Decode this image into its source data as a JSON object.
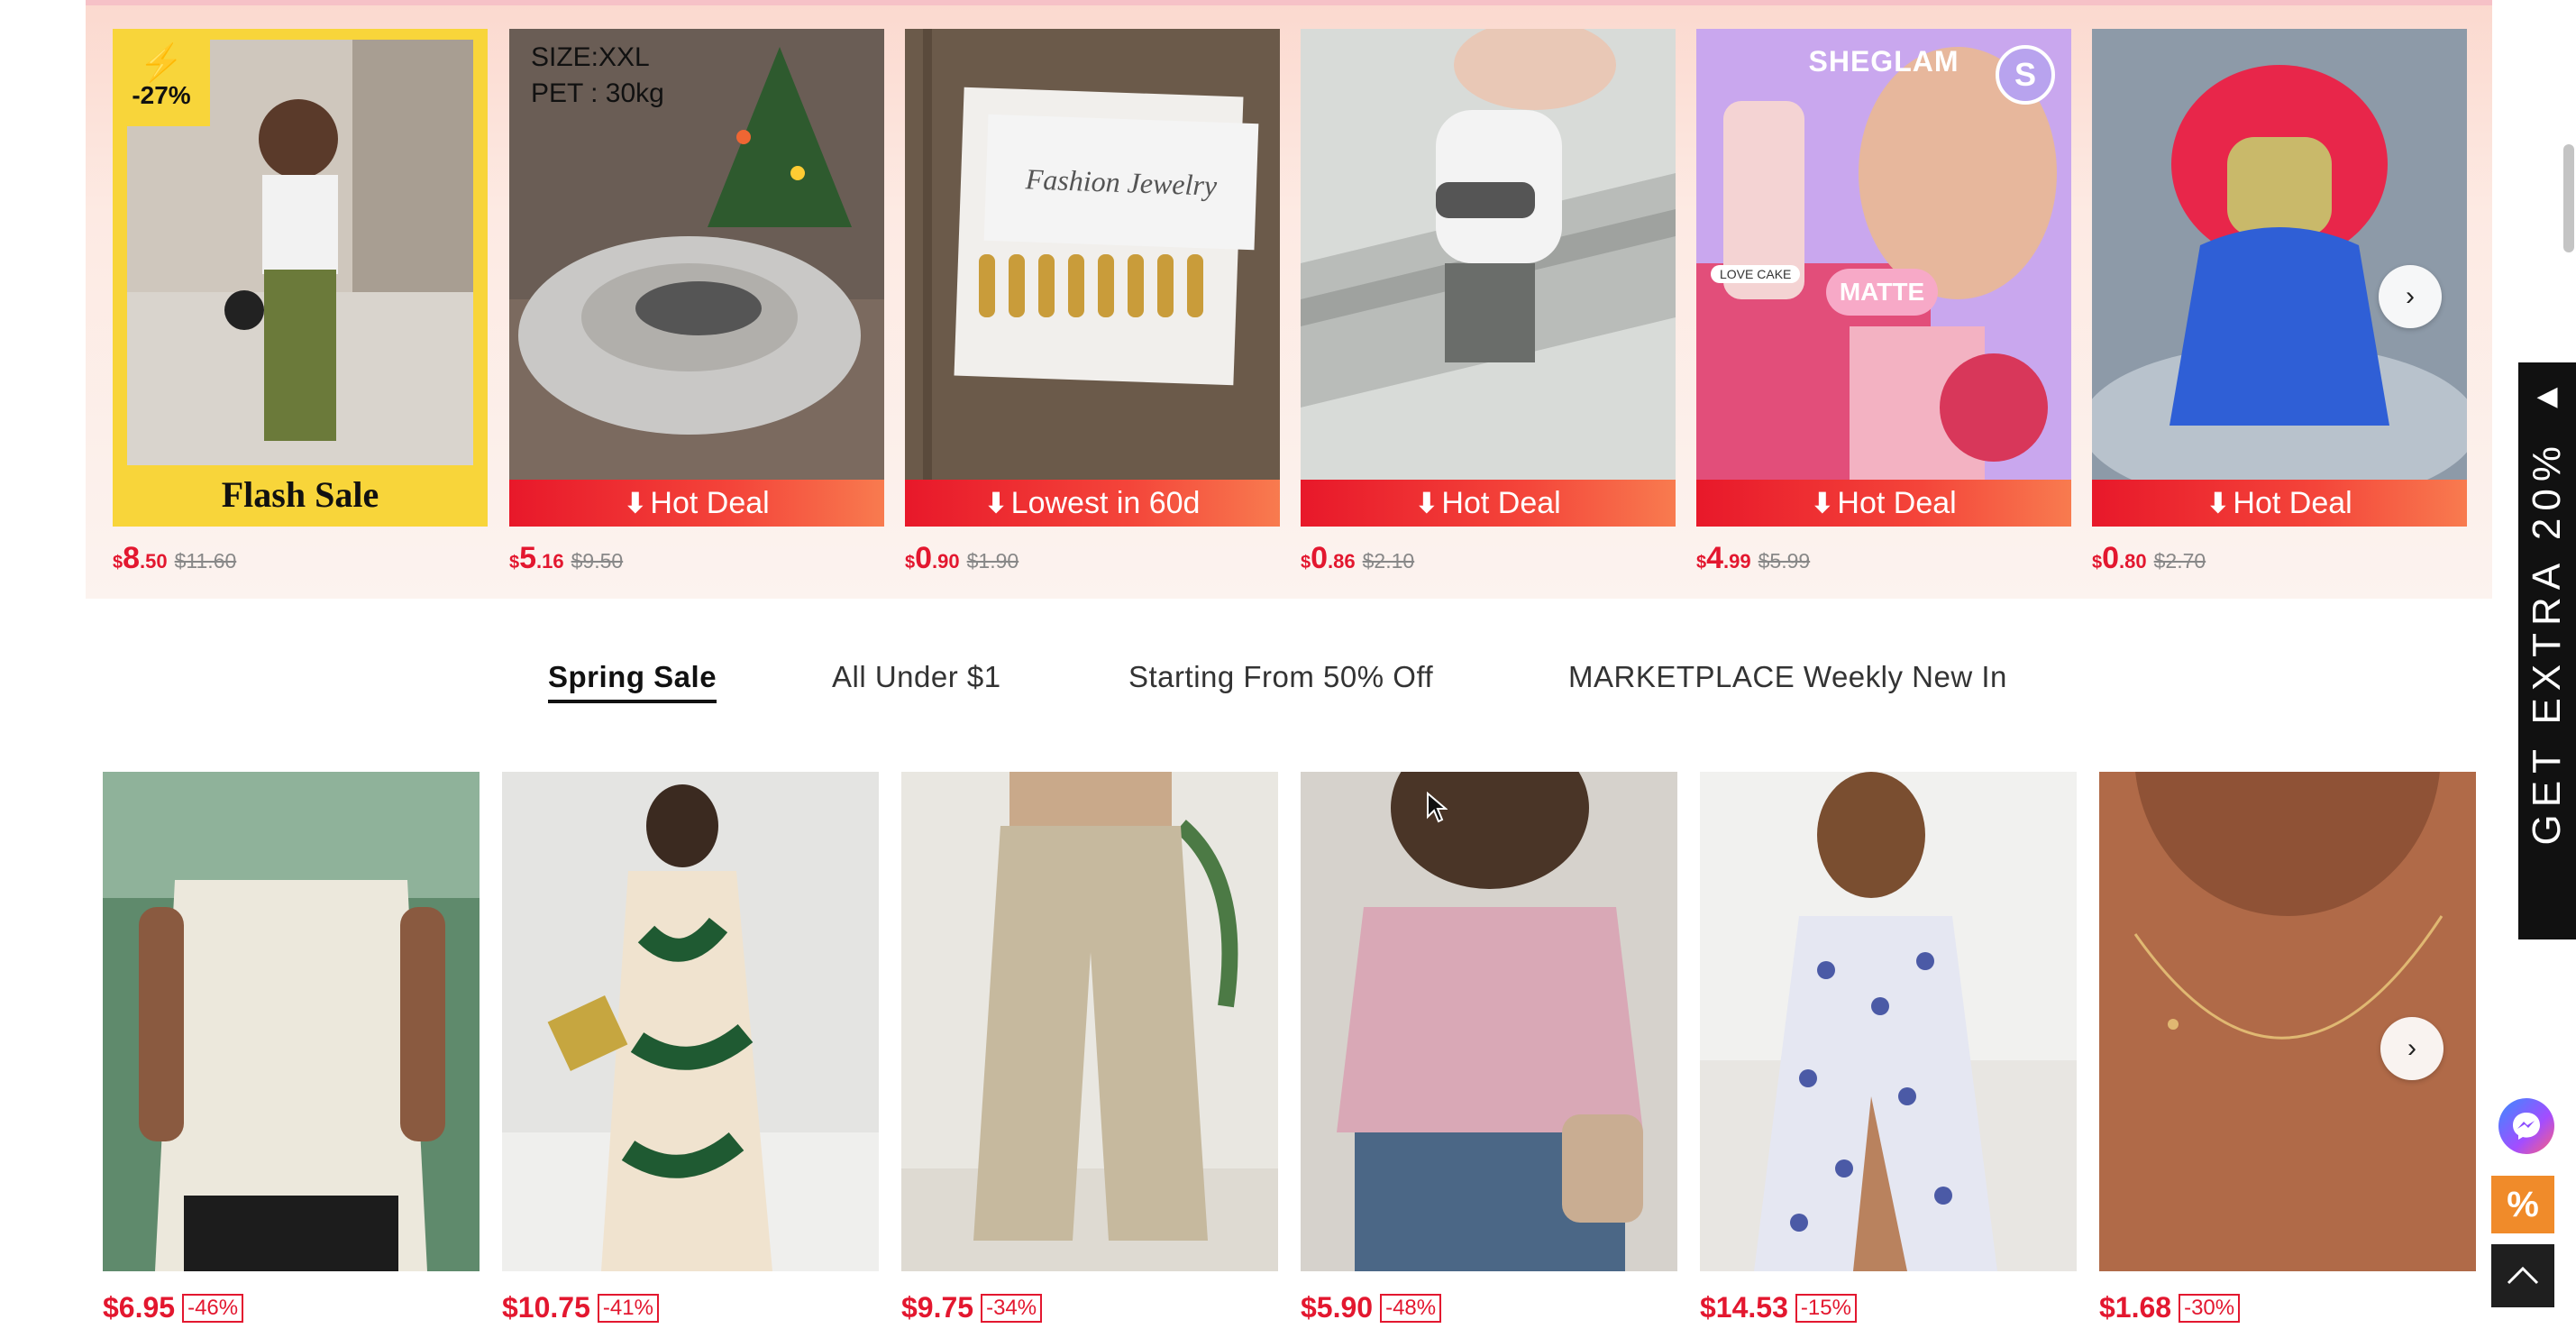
{
  "deals": [
    {
      "badge_discount": "-27%",
      "label": "Flash Sale",
      "currency": "$",
      "price_whole": "8",
      "price_cents": ".50",
      "old_price": "$11.60"
    },
    {
      "size_text": "SIZE:XXL",
      "pet_text": "PET : 30kg",
      "label": "Hot Deal",
      "currency": "$",
      "price_whole": "5",
      "price_cents": ".16",
      "old_price": "$9.50"
    },
    {
      "card_text": "Fashion Jewelry",
      "label": "Lowest in 60d",
      "currency": "$",
      "price_whole": "0",
      "price_cents": ".90",
      "old_price": "$1.90"
    },
    {
      "label": "Hot Deal",
      "currency": "$",
      "price_whole": "0",
      "price_cents": ".86",
      "old_price": "$2.10"
    },
    {
      "brand": "SHEGLAM",
      "brand_letter": "S",
      "chip": "MATTE",
      "small_chip": "LOVE CAKE",
      "label": "Hot Deal",
      "currency": "$",
      "price_whole": "4",
      "price_cents": ".99",
      "old_price": "$5.99"
    },
    {
      "label": "Hot Deal",
      "currency": "$",
      "price_whole": "0",
      "price_cents": ".80",
      "old_price": "$2.70"
    }
  ],
  "tabs": [
    {
      "label": "Spring Sale",
      "active": true
    },
    {
      "label": "All Under $1",
      "active": false
    },
    {
      "label": "Starting From 50% Off",
      "active": false
    },
    {
      "label": "MARKETPLACE Weekly New In",
      "active": false
    }
  ],
  "products": [
    {
      "price": "$6.95",
      "discount": "-46%"
    },
    {
      "price": "$10.75",
      "discount": "-41%"
    },
    {
      "price": "$9.75",
      "discount": "-34%"
    },
    {
      "price": "$5.90",
      "discount": "-48%"
    },
    {
      "price": "$14.53",
      "discount": "-15%"
    },
    {
      "price": "$1.68",
      "discount": "-30%"
    }
  ],
  "side": {
    "extra_banner": "GET EXTRA 20%",
    "coupon_symbol": "%"
  },
  "icons": {
    "next": "chevron-right-icon",
    "collapse": "triangle-left-icon",
    "messenger": "messenger-icon",
    "top": "chevron-up-icon"
  }
}
